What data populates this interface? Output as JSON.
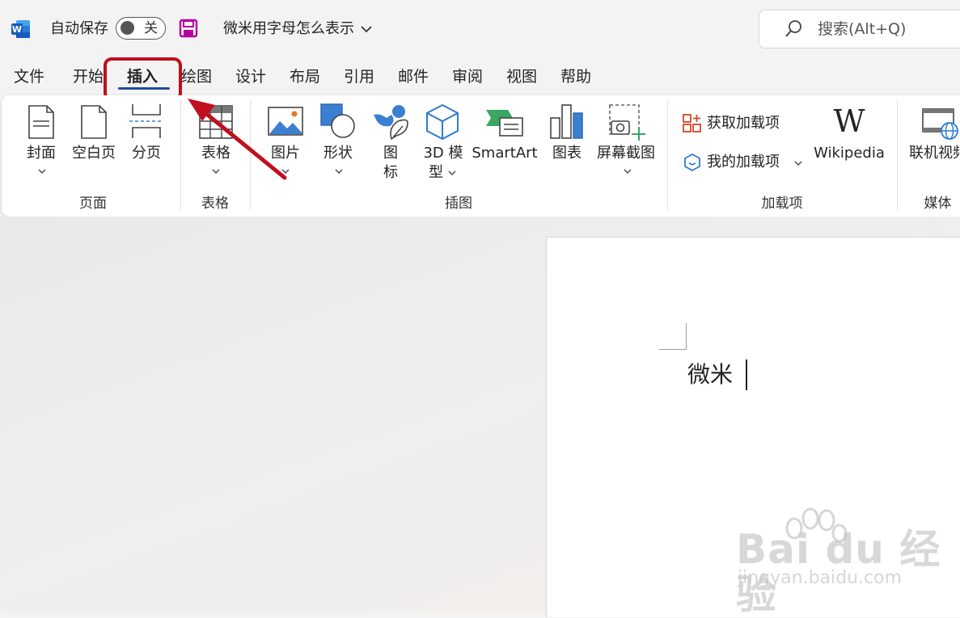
{
  "titlebar": {
    "autosave_label": "自动保存",
    "autosave_state": "关",
    "doc_title": "微米用字母怎么表示",
    "search_placeholder": "搜索(Alt+Q)"
  },
  "tabs": [
    {
      "label": "文件"
    },
    {
      "label": "开始"
    },
    {
      "label": "插入",
      "active": true
    },
    {
      "label": "绘图"
    },
    {
      "label": "设计"
    },
    {
      "label": "布局"
    },
    {
      "label": "引用"
    },
    {
      "label": "邮件"
    },
    {
      "label": "审阅"
    },
    {
      "label": "视图"
    },
    {
      "label": "帮助"
    }
  ],
  "ribbon": {
    "pages_group": {
      "label": "页面",
      "cover": "封面",
      "blank_page": "空白页",
      "page_break": "分页"
    },
    "table_group": {
      "label": "表格",
      "table": "表格"
    },
    "illustrations_group": {
      "label": "插图",
      "pictures": "图片",
      "shapes": "形状",
      "icons_line1": "图",
      "icons_line2": "标",
      "models_line1": "3D 模",
      "models_line2": "型",
      "smartart": "SmartArt",
      "chart": "图表",
      "screenshot": "屏幕截图"
    },
    "addins_group": {
      "label": "加载项",
      "get_addins": "获取加载项",
      "my_addins": "我的加载项",
      "wikipedia": "Wikipedia",
      "wikipedia_logo": "W"
    },
    "media_group": {
      "label": "媒体",
      "online_video": "联机视频"
    }
  },
  "document": {
    "text": "微米"
  },
  "watermark": {
    "brand": "Bai  du 经验",
    "url": "jingyan.baidu.com"
  },
  "colors": {
    "word_blue": "#185abd",
    "highlight_red": "#c00f1e",
    "save_purple": "#b4009e",
    "tab_underline": "#1f4e99"
  }
}
